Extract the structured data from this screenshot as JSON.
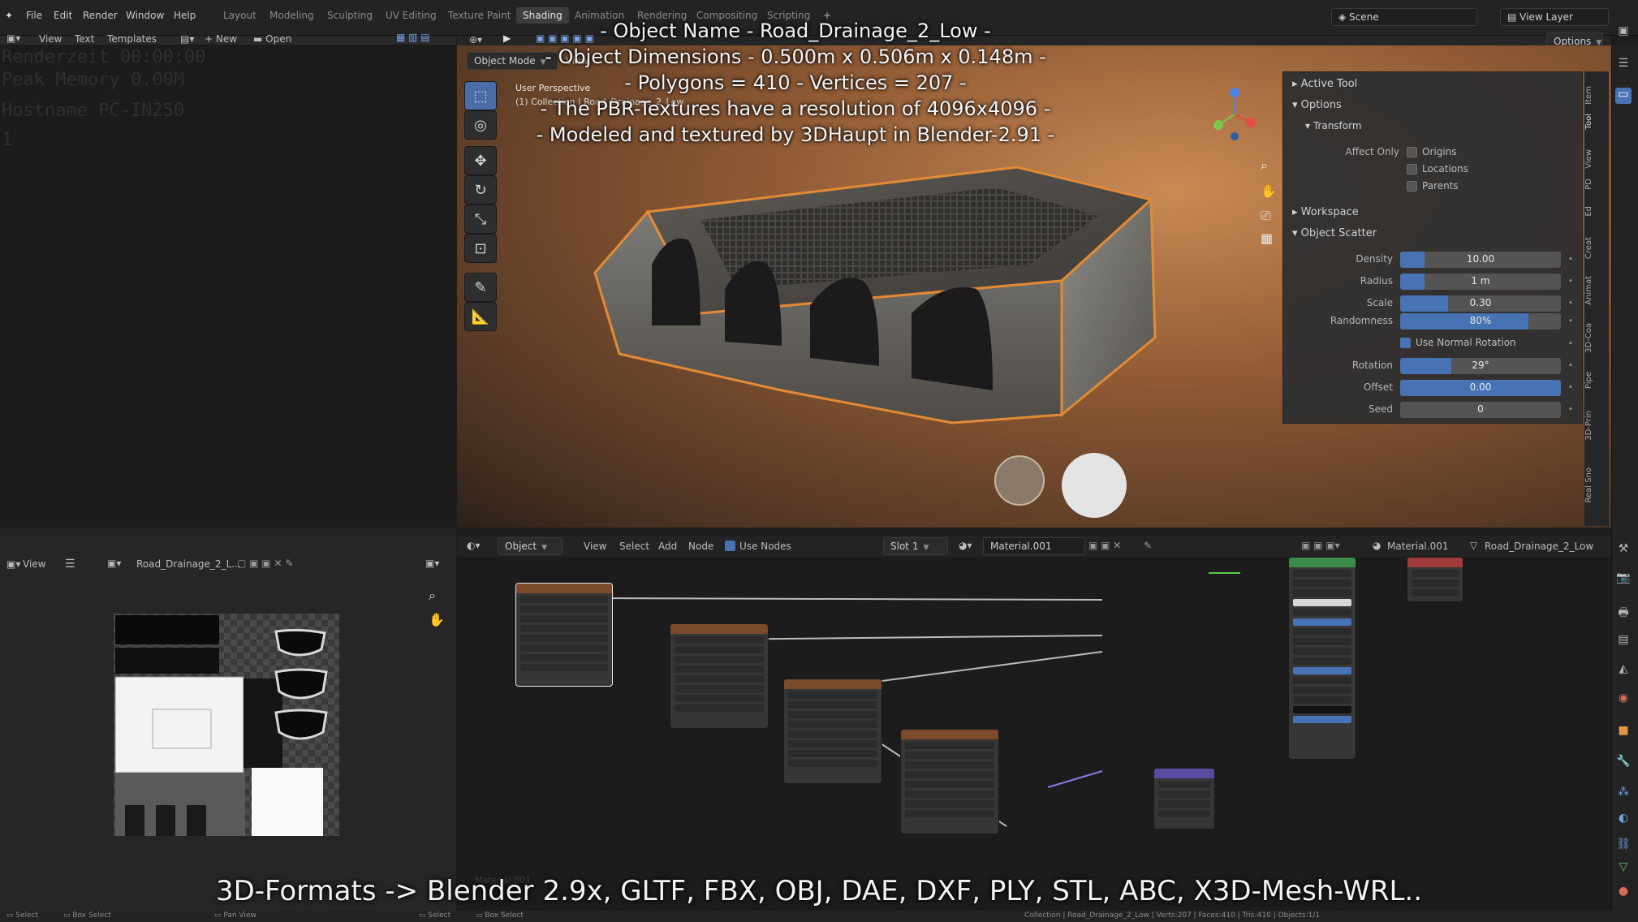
{
  "topbar": {
    "menu": [
      "File",
      "Edit",
      "Render",
      "Window",
      "Help"
    ],
    "workspaces": [
      "Layout",
      "Modeling",
      "Sculpting",
      "UV Editing",
      "Texture Paint",
      "Shading",
      "Animation",
      "Rendering",
      "Compositing",
      "Scripting"
    ],
    "active_workspace": "Shading",
    "add_tab": "+",
    "scene_label": "Scene",
    "view_layer_label": "View Layer"
  },
  "text_editor": {
    "header": {
      "view": "View",
      "text": "Text",
      "templates": "Templates",
      "new": "New",
      "open": "Open"
    },
    "lines": [
      "Renderzeit 00:00:00",
      "Peak Memory 0.00M",
      "Hostname PC-IN250",
      "1"
    ]
  },
  "viewport": {
    "mode": "Object Mode",
    "view_menu": "View",
    "options": "Options",
    "perspective_label": "User Perspective",
    "collection_label": "(1) Collection | Road_Drainage_2_Low"
  },
  "overlay_text": [
    "- Object Name - Road_Drainage_2_Low -",
    "- Object Dimensions -  0.500m x 0.506m x 0.148m -",
    "- Polygons = 410  -  Vertices = 207 -",
    "- The PBR-Textures have a resolution of 4096x4096 -",
    "- Modeled and textured by 3DHaupt in Blender-2.91 -"
  ],
  "sidebar": {
    "active_tool": "Active Tool",
    "options": "Options",
    "transform": "Transform",
    "affect_only": "Affect Only",
    "origins": "Origins",
    "locations": "Locations",
    "parents": "Parents",
    "workspace": "Workspace",
    "object_scatter": "Object Scatter",
    "fields": [
      {
        "label": "Density",
        "value": "10.00",
        "fill": 0.15
      },
      {
        "label": "Radius",
        "value": "1 m",
        "fill": 0.15
      },
      {
        "label": "Scale",
        "value": "0.30",
        "fill": 0.3
      },
      {
        "label": "Randomness",
        "value": "80%",
        "fill": 0.8
      }
    ],
    "use_normal_rotation": "Use Normal Rotation",
    "fields2": [
      {
        "label": "Rotation",
        "value": "29°",
        "fill": 0.32
      },
      {
        "label": "Offset",
        "value": "0.00",
        "fill": 1.0
      },
      {
        "label": "Seed",
        "value": "0",
        "fill": 0.0
      }
    ],
    "tabs": [
      "Item",
      "Tool",
      "View",
      "PD",
      "Ed",
      "Creat",
      "Animat",
      "3D-Coa",
      "Pipe",
      "3D-Prin",
      "Real Sno"
    ]
  },
  "image_editor": {
    "view": "View",
    "image_name": "Road_Drainage_2_L..."
  },
  "node_editor": {
    "object": "Object",
    "view": "View",
    "select": "Select",
    "add": "Add",
    "node": "Node",
    "use_nodes": "Use Nodes",
    "slot": "Slot 1",
    "material": "Material.001",
    "material_right": "Material.001",
    "object_right": "Road_Drainage_2_Low",
    "footer_label": "Material.001"
  },
  "caption": "3D-Formats -> Blender 2.9x, GLTF, FBX, OBJ, DAE, DXF, PLY, STL, ABC, X3D-Mesh-WRL..",
  "statusbar": {
    "select": "Select",
    "box_select": "Box Select",
    "pan_view": "Pan View",
    "select2": "Select",
    "box_select2": "Box Select",
    "stats": "Collection | Road_Drainage_2_Low | Verts:207 | Faces:410 | Tris:410 | Objects:1/1"
  }
}
